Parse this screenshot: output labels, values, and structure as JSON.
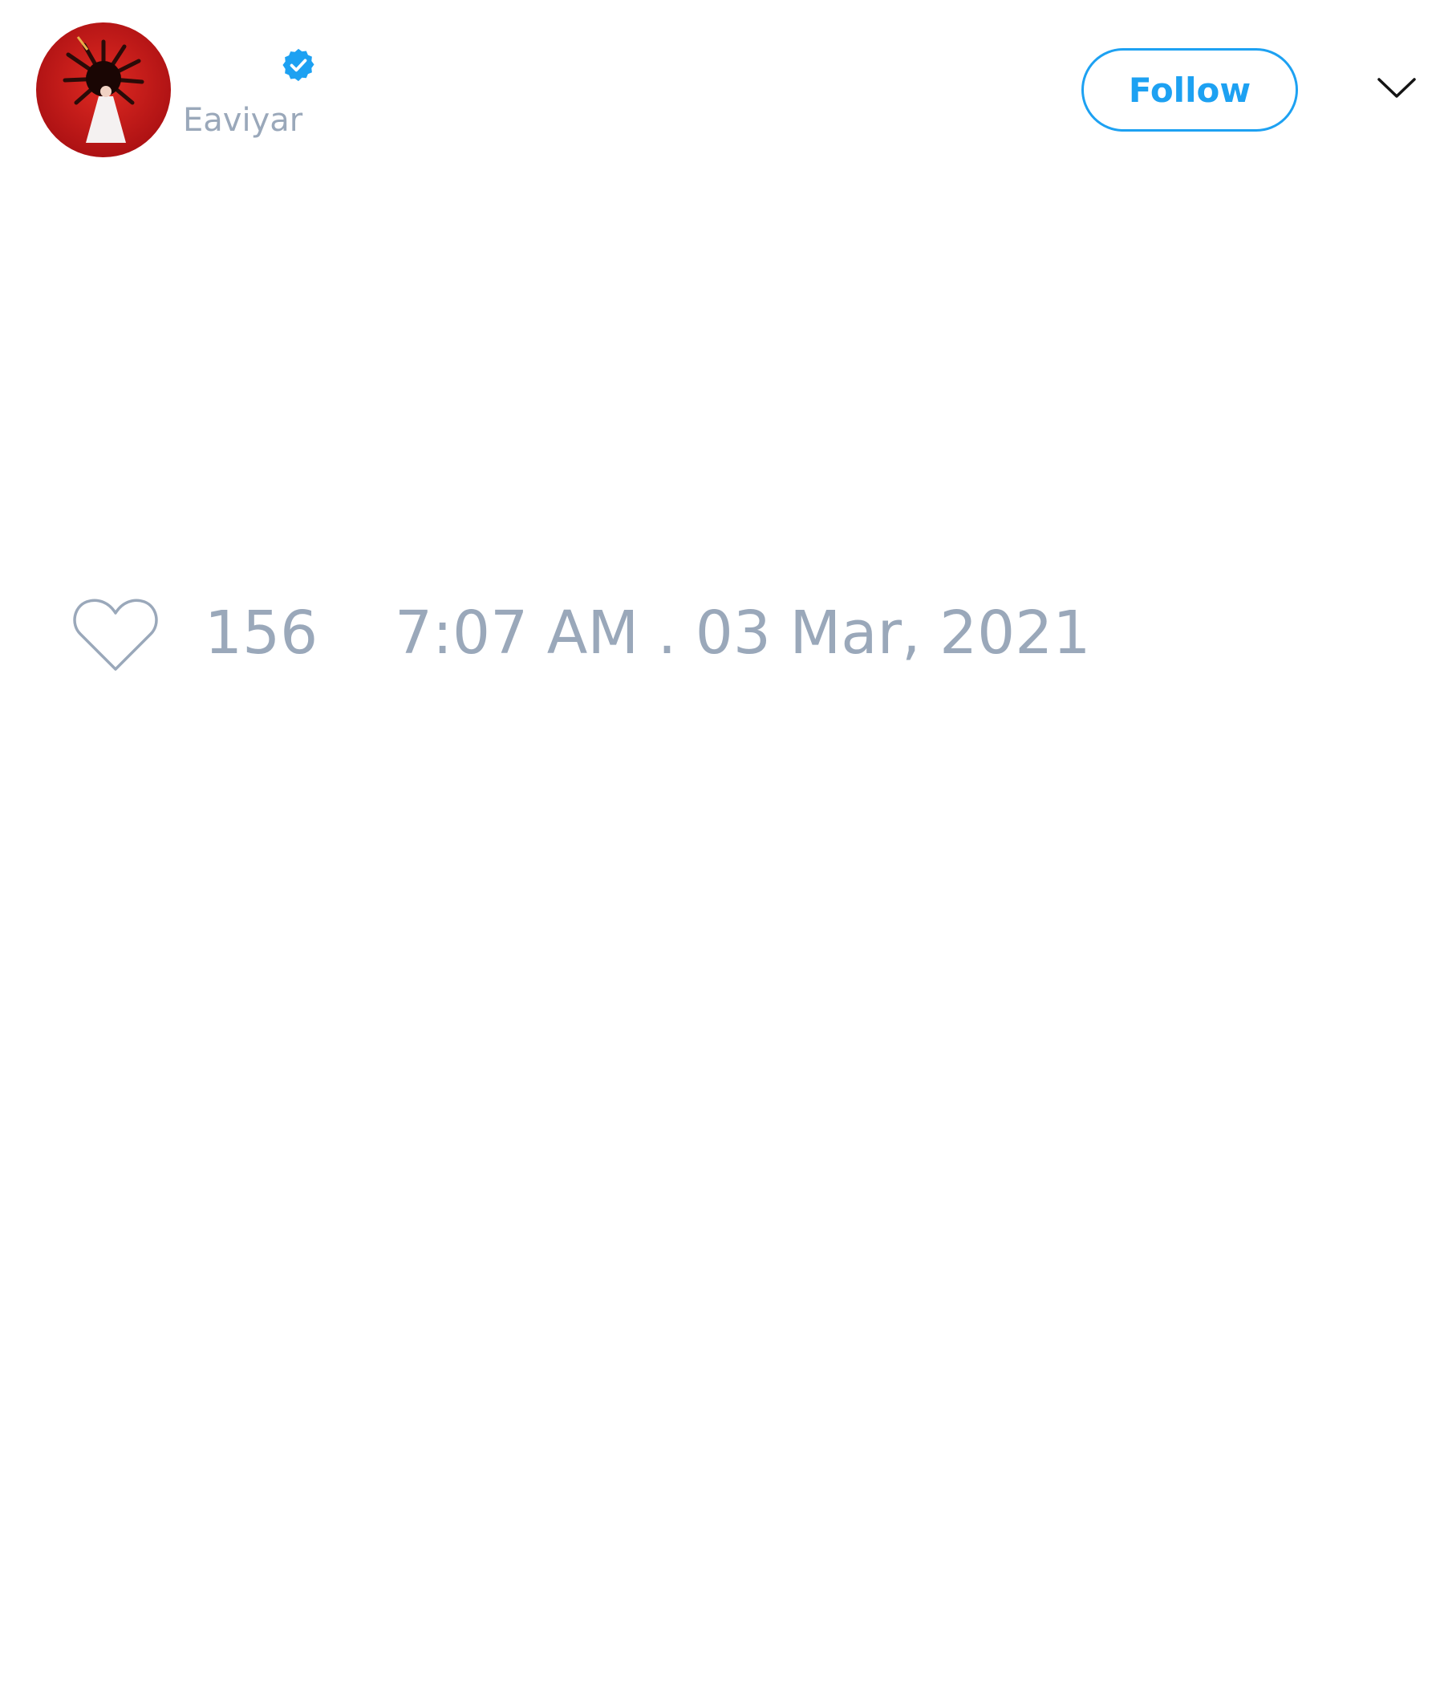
{
  "header": {
    "handle": "Eaviyar",
    "follow_label": "Follow",
    "avatar_icon": "profile-avatar",
    "verified_icon": "verified-badge-icon",
    "menu_icon": "chevron-down-icon"
  },
  "engagement": {
    "like_icon": "heart-icon",
    "like_count": "156",
    "timestamp": "7:07 AM . 03 Mar, 2021"
  },
  "colors": {
    "accent": "#1da1f2",
    "muted_text": "#9aa8ba",
    "avatar_background": "#c8191c"
  }
}
